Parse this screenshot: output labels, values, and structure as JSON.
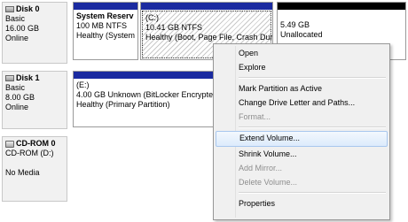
{
  "disks": [
    {
      "name": "Disk 0",
      "type": "Basic",
      "size": "16.00 GB",
      "status": "Online"
    },
    {
      "name": "Disk 1",
      "type": "Basic",
      "size": "8.00 GB",
      "status": "Online"
    },
    {
      "name": "CD-ROM 0",
      "type": "CD-ROM (D:)",
      "status": "No Media"
    }
  ],
  "disk0_partitions": [
    {
      "name": "System Reserv",
      "size": "100 MB NTFS",
      "status": "Healthy (System"
    },
    {
      "name": "(C:)",
      "size": "10.41 GB NTFS",
      "status": "Healthy (Boot, Page File, Crash Dur"
    },
    {
      "size": "5.49 GB",
      "status": "Unallocated"
    }
  ],
  "disk1_partitions": [
    {
      "name": "(E:)",
      "size": "4.00 GB Unknown (BitLocker Encrypted",
      "status": "Healthy (Primary Partition)"
    }
  ],
  "menu": {
    "items": [
      {
        "label": "Open",
        "disabled": false
      },
      {
        "label": "Explore",
        "disabled": false
      },
      {
        "label": "Mark Partition as Active",
        "disabled": false
      },
      {
        "label": "Change Drive Letter and Paths...",
        "disabled": false
      },
      {
        "label": "Format...",
        "disabled": true
      },
      {
        "label": "Extend Volume...",
        "disabled": false
      },
      {
        "label": "Shrink Volume...",
        "disabled": false
      },
      {
        "label": "Add Mirror...",
        "disabled": true
      },
      {
        "label": "Delete Volume...",
        "disabled": true
      },
      {
        "label": "Properties",
        "disabled": false
      }
    ]
  },
  "colors": {
    "primary_bar": "#1a2aa0",
    "unallocated_bar": "#000000",
    "menu_hover": "#dcebfc"
  }
}
